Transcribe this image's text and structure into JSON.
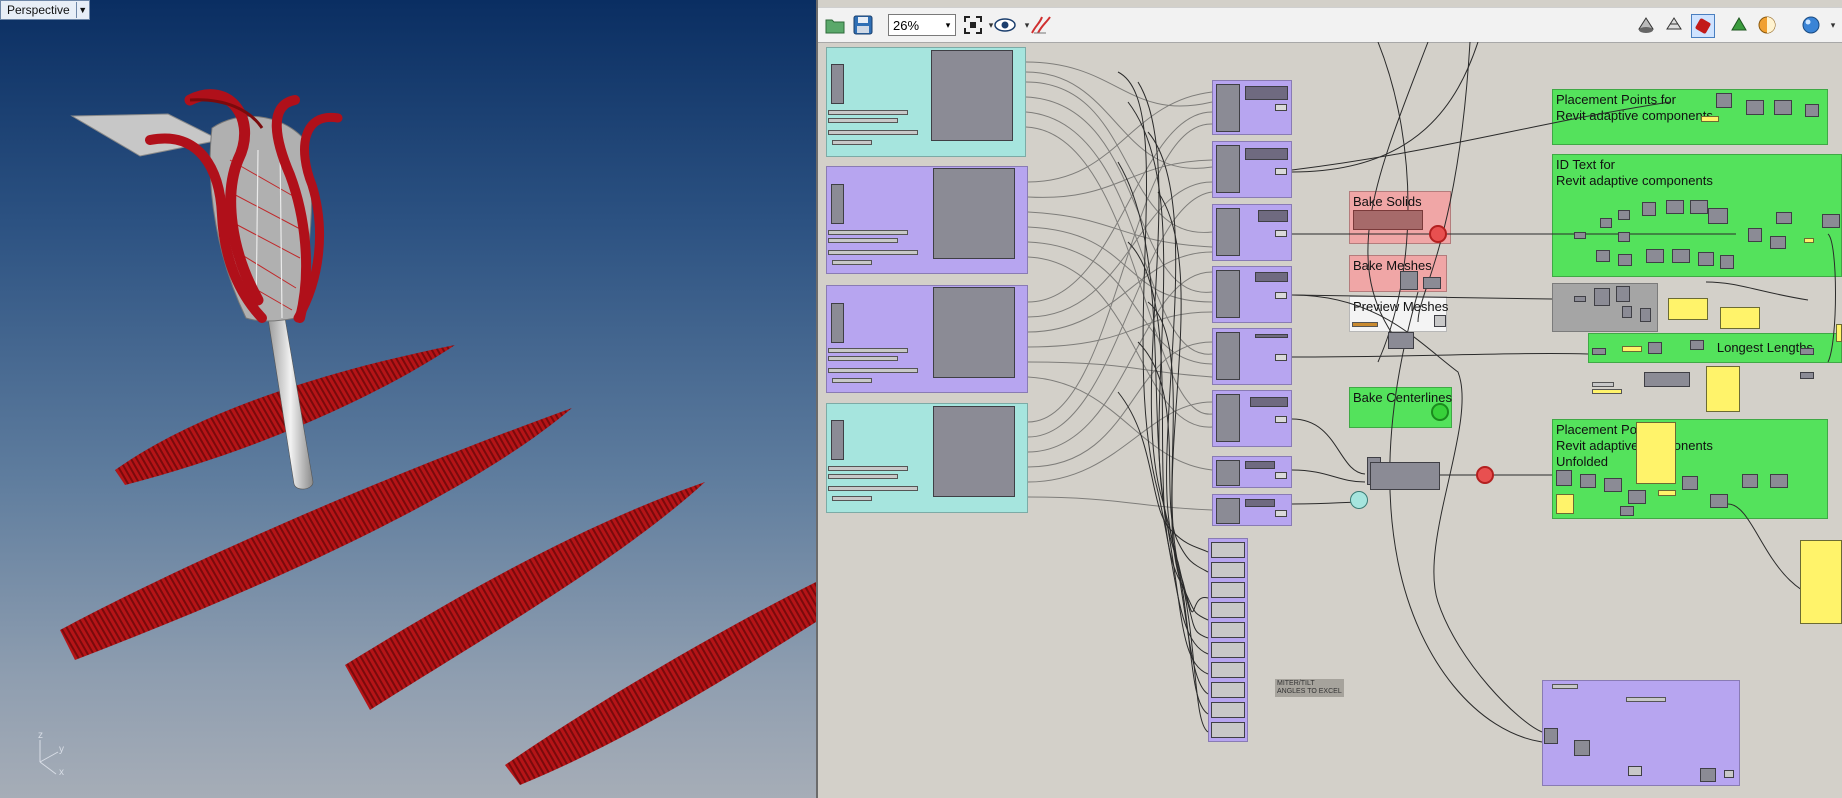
{
  "viewport": {
    "label": "Perspective",
    "axes": {
      "z": "z",
      "y": "y",
      "x": "x"
    }
  },
  "toolbar": {
    "zoom": "26%",
    "icons": [
      "open-file-icon",
      "save-file-icon",
      "zoom-extents-icon",
      "preview-eye-icon",
      "sketch-icon",
      "preview-off-icon",
      "preview-wire-icon",
      "preview-shaded-icon",
      "selected-only-icon",
      "document-preview-icon",
      "render-sphere-icon"
    ]
  },
  "canvas": {
    "groups": {
      "bake_solids": "Bake Solids",
      "bake_meshes": "Bake Meshes",
      "preview_meshes": "Preview Meshes",
      "bake_centerlines": "Bake Centerlines",
      "placement_points": "Placement Points for\nRevit adaptive components",
      "id_text": "ID Text for\nRevit adaptive components",
      "longest_lengths": "Longest Lengths",
      "placement_unfolded": "Placement Points for\nRevit adaptive components\nUnfolded",
      "scribble": "MITER/TILT\nANGLES TO EXCEL"
    }
  },
  "colors": {
    "cyan_group": "#a6e5de",
    "purple_group": "#b7a5f0",
    "green_group": "#54e25c",
    "red_group": "#f0a6a6",
    "panel_yellow": "#fff36a",
    "geometry_red": "#a10d10"
  }
}
